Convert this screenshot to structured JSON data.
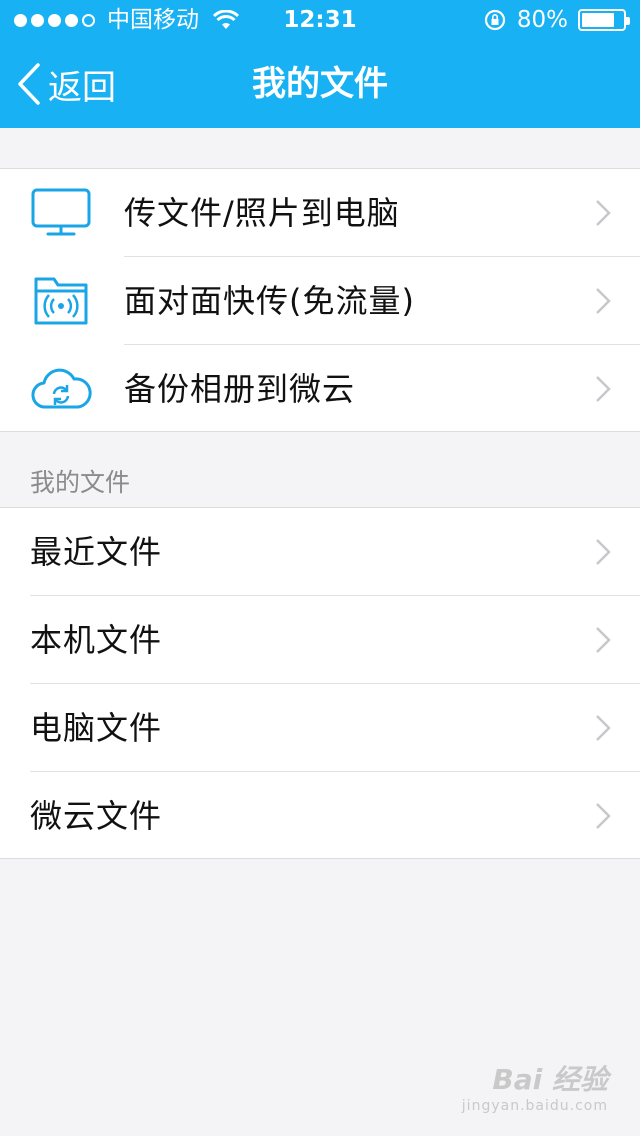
{
  "status_bar": {
    "carrier": "中国移动",
    "time": "12:31",
    "battery_percent": "80%",
    "battery_level": 0.8,
    "signal_bars_filled": 4,
    "signal_bars_total": 5
  },
  "nav": {
    "back_label": "返回",
    "title": "我的文件"
  },
  "transfer_group": {
    "items": [
      {
        "label": "传文件/照片到电脑",
        "icon": "monitor-icon"
      },
      {
        "label": "面对面快传(免流量)",
        "icon": "folder-wireless-icon"
      },
      {
        "label": "备份相册到微云",
        "icon": "cloud-sync-icon"
      }
    ]
  },
  "files_section": {
    "title": "我的文件",
    "items": [
      {
        "label": "最近文件"
      },
      {
        "label": "本机文件"
      },
      {
        "label": "电脑文件"
      },
      {
        "label": "微云文件"
      }
    ]
  },
  "watermark": {
    "main": "Bai 经验",
    "sub": "jingyan.baidu.com"
  },
  "colors": {
    "accent": "#17b1f4",
    "icon_blue": "#1aa5e6",
    "background": "#f4f4f6",
    "chevron": "#c7c7cc"
  }
}
